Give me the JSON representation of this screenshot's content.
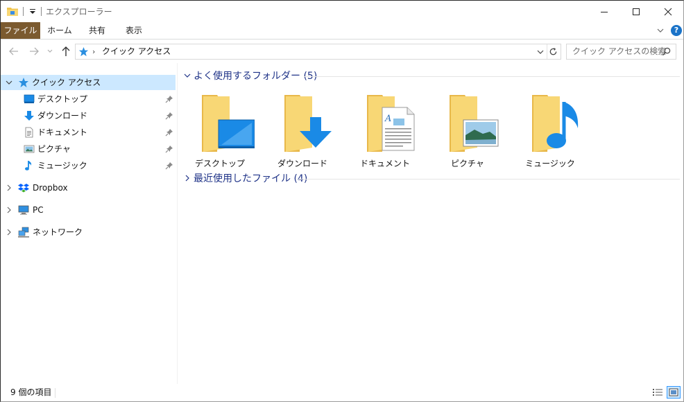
{
  "window": {
    "title": "エクスプローラー"
  },
  "ribbon": {
    "tabs": [
      "ファイル",
      "ホーム",
      "共有",
      "表示"
    ],
    "help": "?"
  },
  "address": {
    "path": "クイック アクセス",
    "separator": "›"
  },
  "search": {
    "placeholder": "クイック アクセスの検索"
  },
  "sidebar": {
    "quick_access": "クイック アクセス",
    "pinned": [
      {
        "label": "デスクトップ",
        "icon": "desktop-icon"
      },
      {
        "label": "ダウンロード",
        "icon": "download-icon"
      },
      {
        "label": "ドキュメント",
        "icon": "documents-icon"
      },
      {
        "label": "ピクチャ",
        "icon": "pictures-icon"
      },
      {
        "label": "ミュージック",
        "icon": "music-icon"
      }
    ],
    "dropbox": "Dropbox",
    "pc": "PC",
    "network": "ネットワーク"
  },
  "content": {
    "frequent_header": "よく使用するフォルダー (5)",
    "recent_header": "最近使用したファイル (4)",
    "folders": [
      "デスクトップ",
      "ダウンロード",
      "ドキュメント",
      "ピクチャ",
      "ミュージック"
    ]
  },
  "status": {
    "item_count": "9 個の項目"
  },
  "colors": {
    "accent": "#1e3287",
    "file_tab": "#7b5a2f",
    "selection": "#cce8ff",
    "folder": "#f8d775",
    "blue_icon": "#1a8ae6"
  }
}
